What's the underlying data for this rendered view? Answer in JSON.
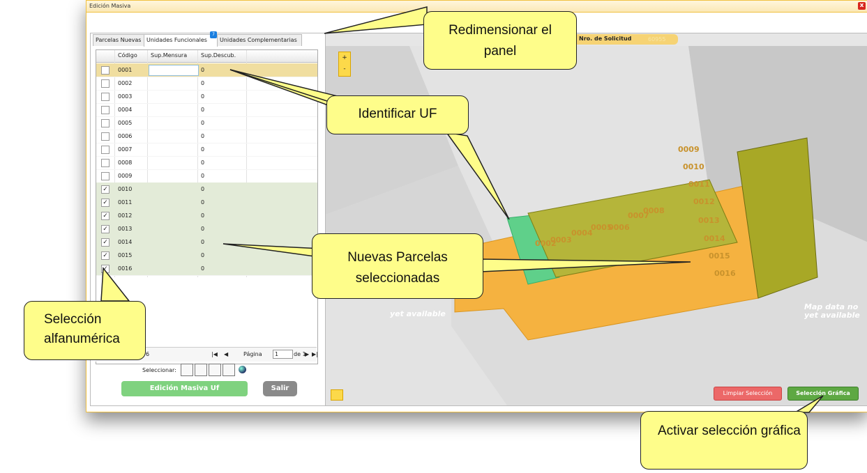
{
  "window": {
    "title": "Edición Masiva",
    "close_glyph": "x"
  },
  "tabs": [
    {
      "label": "Parcelas Nuevas"
    },
    {
      "label": "Unidades Funcionales",
      "badge": "7"
    },
    {
      "label": "Unidades Complementarias"
    }
  ],
  "grid": {
    "headers": [
      "Código",
      "Sup.Mensura",
      "Sup.Descub."
    ],
    "rows": [
      {
        "code": "0001",
        "val": "0",
        "checked": false
      },
      {
        "code": "0002",
        "val": "0",
        "checked": false
      },
      {
        "code": "0003",
        "val": "0",
        "checked": false
      },
      {
        "code": "0004",
        "val": "0",
        "checked": false
      },
      {
        "code": "0005",
        "val": "0",
        "checked": false
      },
      {
        "code": "0006",
        "val": "0",
        "checked": false
      },
      {
        "code": "0007",
        "val": "0",
        "checked": false
      },
      {
        "code": "0008",
        "val": "0",
        "checked": false
      },
      {
        "code": "0009",
        "val": "0",
        "checked": false
      },
      {
        "code": "0010",
        "val": "0",
        "checked": true
      },
      {
        "code": "0011",
        "val": "0",
        "checked": true
      },
      {
        "code": "0012",
        "val": "0",
        "checked": true
      },
      {
        "code": "0013",
        "val": "0",
        "checked": true
      },
      {
        "code": "0014",
        "val": "0",
        "checked": true
      },
      {
        "code": "0015",
        "val": "0",
        "checked": true
      },
      {
        "code": "0016",
        "val": "0",
        "checked": true
      }
    ]
  },
  "pager": {
    "count": "6",
    "page_label": "Página",
    "page_value": "1",
    "of_label": "de 1"
  },
  "select_bar": {
    "label": "Seleccionar:"
  },
  "buttons": {
    "edit": "Edición Masiva Uf",
    "exit": "Salir"
  },
  "map": {
    "solicitud_label": "Nro. de Solicitud",
    "solicitud_value": "60955",
    "zoom_in": "+",
    "zoom_out": "-",
    "watermark_left": "yet available",
    "watermark_right_1": "Map data no",
    "watermark_right_2": "yet available",
    "btn_clear": "Limpiar Selección",
    "btn_graphic": "Selección Gráfica",
    "parcel_labels": [
      "0009",
      "0010",
      "0011",
      "0012",
      "0013",
      "0014",
      "0015",
      "0016",
      "0008",
      "0007",
      "0006",
      "0005",
      "0004",
      "0003",
      "0002"
    ]
  },
  "callouts": {
    "resize": "Redimensionar el panel",
    "identify": "Identificar UF",
    "new_parcels": "Nuevas Parcelas seleccionadas",
    "alpha_select": "Selección alfanumérica",
    "activate": "Activar selección gráfica"
  },
  "colors": {
    "orange": "#f5b240",
    "olive": "#a8a826",
    "green_sel": "#5fd08a",
    "callout": "#fefd8a"
  }
}
